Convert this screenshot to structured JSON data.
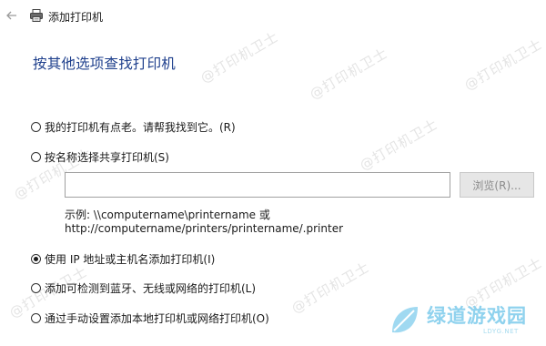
{
  "window": {
    "title": "添加打印机",
    "back_icon": "back-arrow-icon",
    "app_icon": "printer-icon"
  },
  "heading": "按其他选项查找打印机",
  "options": [
    {
      "label": "我的打印机有点老。请帮我找到它。(R)",
      "checked": false
    },
    {
      "label": "按名称选择共享打印机(S)",
      "checked": false
    },
    {
      "label": "使用 IP 地址或主机名添加打印机(I)",
      "checked": true
    },
    {
      "label": "添加可检测到蓝牙、无线或网络的打印机(L)",
      "checked": false
    },
    {
      "label": "通过手动设置添加本地打印机或网络打印机(O)",
      "checked": false
    }
  ],
  "shared_printer": {
    "value": "",
    "browse_label": "浏览(R)...",
    "example_line1": "示例: \\\\computername\\printername 或",
    "example_line2": "http://computername/printers/printername/.printer"
  },
  "watermark": "@打印机卫士",
  "logo": {
    "name": "绿道游戏园",
    "sub": "LDYG.NET"
  },
  "colors": {
    "heading": "#1e3f8c",
    "watermark": "#cfcfcf",
    "logo": "#8fd2ee"
  }
}
